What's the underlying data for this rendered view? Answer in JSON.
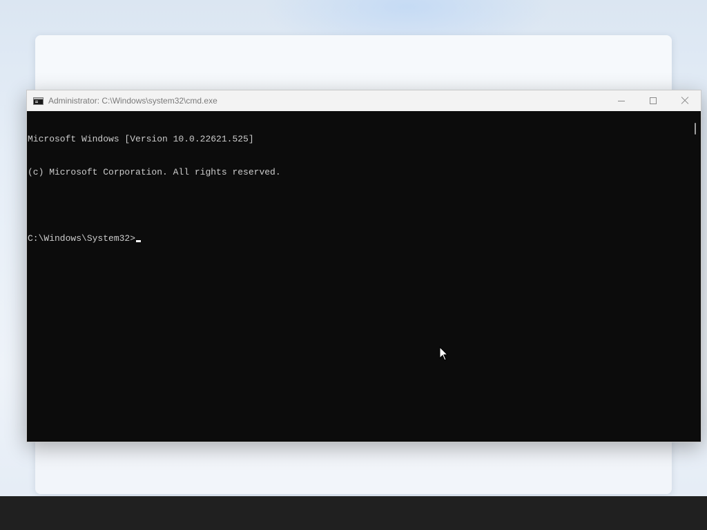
{
  "window": {
    "title": "Administrator: C:\\Windows\\system32\\cmd.exe",
    "app_icon": "cmd-icon",
    "controls": {
      "minimize": "minimize-icon",
      "maximize": "maximize-icon",
      "close": "close-icon"
    }
  },
  "console": {
    "lines": [
      "Microsoft Windows [Version 10.0.22621.525]",
      "(c) Microsoft Corporation. All rights reserved.",
      ""
    ],
    "prompt": "C:\\Windows\\System32>"
  },
  "colors": {
    "console_background": "#0c0c0c",
    "console_text": "#cccccc",
    "titlebar": "#f3f3f3",
    "taskbar": "#202020"
  }
}
